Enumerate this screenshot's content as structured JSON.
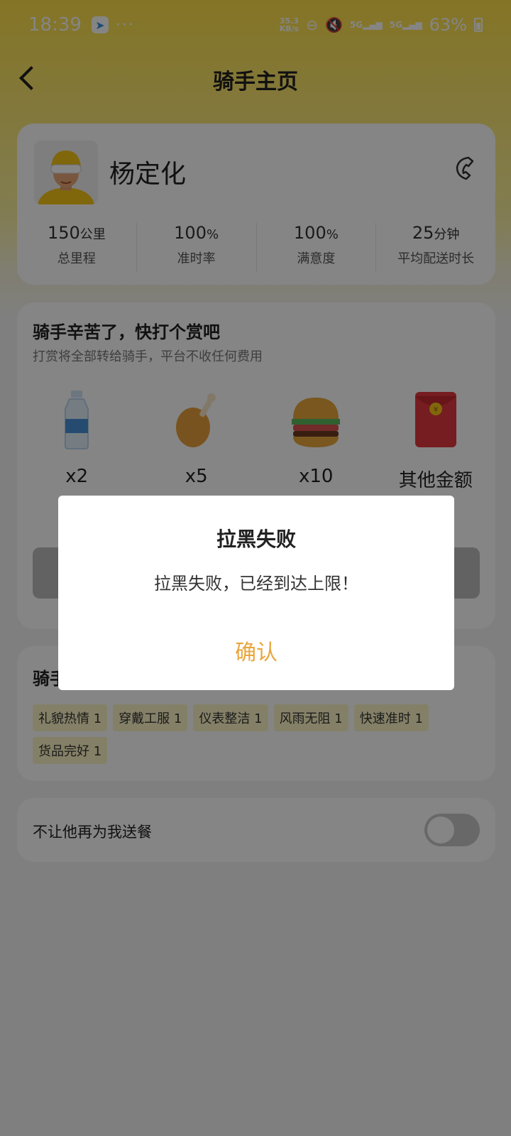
{
  "status_bar": {
    "time": "18:39",
    "net_speed_top": "35.3",
    "net_speed_bottom": "KB/s",
    "signal1": "5G",
    "signal2": "5G",
    "battery": "63%"
  },
  "nav": {
    "title": "骑手主页"
  },
  "rider": {
    "name": "杨定化",
    "stats": [
      {
        "value": "150",
        "unit": "公里",
        "label": "总里程"
      },
      {
        "value": "100",
        "unit": "%",
        "label": "准时率"
      },
      {
        "value": "100",
        "unit": "%",
        "label": "满意度"
      },
      {
        "value": "25",
        "unit": "分钟",
        "label": "平均配送时长"
      }
    ]
  },
  "tip": {
    "title": "骑手辛苦了，快打个赏吧",
    "subtitle": "打赏将全部转给骑手，平台不收任何费用",
    "gifts": [
      {
        "icon": "water-bottle-icon",
        "label": "x2"
      },
      {
        "icon": "chicken-leg-icon",
        "label": "x5"
      },
      {
        "icon": "burger-icon",
        "label": "x10"
      },
      {
        "icon": "red-envelope-icon",
        "label": "其他金额"
      }
    ]
  },
  "evaluation": {
    "title": "骑手",
    "tags": [
      "礼貌热情 1",
      "穿戴工服 1",
      "仪表整洁 1",
      "风雨无阻 1",
      "快速准时 1",
      "货品完好 1"
    ]
  },
  "block": {
    "label": "不让他再为我送餐",
    "enabled": false
  },
  "dialog": {
    "title": "拉黑失败",
    "message": "拉黑失败，已经到达上限！",
    "confirm": "确认"
  },
  "colors": {
    "accent": "#e9a63c",
    "brand_yellow": "#fde048",
    "tag_bg": "#fef6c6"
  }
}
